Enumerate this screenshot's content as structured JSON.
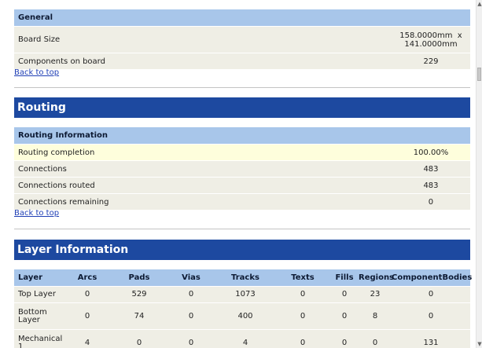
{
  "general": {
    "header": "General",
    "rows": [
      {
        "label": "Board Size",
        "value": "158.0000mm  x\n141.0000mm"
      },
      {
        "label": "Components on board",
        "value": "229"
      }
    ]
  },
  "back_to_top": "Back to top",
  "routing": {
    "title": "Routing",
    "header": "Routing Information",
    "rows": [
      {
        "label": "Routing completion",
        "value": "100.00%"
      },
      {
        "label": "Connections",
        "value": "483"
      },
      {
        "label": "Connections routed",
        "value": "483"
      },
      {
        "label": "Connections remaining",
        "value": "0"
      }
    ]
  },
  "layers": {
    "title": "Layer Information",
    "columns": [
      "Layer",
      "Arcs",
      "Pads",
      "Vias",
      "Tracks",
      "Texts",
      "Fills",
      "Regions",
      "ComponentBodies"
    ],
    "rows": [
      [
        "Top Layer",
        "0",
        "529",
        "0",
        "1073",
        "0",
        "0",
        "23",
        "0"
      ],
      [
        "Bottom Layer",
        "0",
        "74",
        "0",
        "400",
        "0",
        "0",
        "8",
        "0"
      ],
      [
        "Mechanical 1",
        "4",
        "0",
        "0",
        "4",
        "0",
        "0",
        "0",
        "131"
      ]
    ]
  },
  "scrollbar": {
    "up_icon": "triangle-up-icon",
    "down_icon": "triangle-down-icon"
  }
}
